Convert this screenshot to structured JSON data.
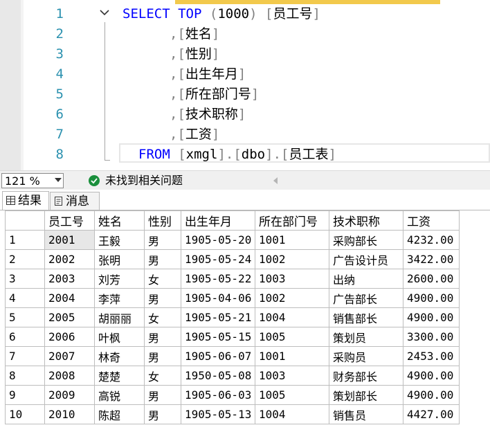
{
  "editor": {
    "lines": [
      {
        "num": "1",
        "parts": [
          [
            "kw",
            "SELECT"
          ],
          [
            "sp",
            " "
          ],
          [
            "kw",
            "TOP"
          ],
          [
            "sp",
            " "
          ],
          [
            "br",
            "("
          ],
          [
            "num",
            "1000"
          ],
          [
            "br",
            ")"
          ],
          [
            "sp",
            " "
          ],
          [
            "br",
            "["
          ],
          [
            "blk",
            "员工号"
          ],
          [
            "br",
            "]"
          ]
        ]
      },
      {
        "num": "2",
        "parts": [
          [
            "br",
            ","
          ],
          [
            "br",
            "["
          ],
          [
            "blk",
            "姓名"
          ],
          [
            "br",
            "]"
          ]
        ]
      },
      {
        "num": "3",
        "parts": [
          [
            "br",
            ","
          ],
          [
            "br",
            "["
          ],
          [
            "blk",
            "性别"
          ],
          [
            "br",
            "]"
          ]
        ]
      },
      {
        "num": "4",
        "parts": [
          [
            "br",
            ","
          ],
          [
            "br",
            "["
          ],
          [
            "blk",
            "出生年月"
          ],
          [
            "br",
            "]"
          ]
        ]
      },
      {
        "num": "5",
        "parts": [
          [
            "br",
            ","
          ],
          [
            "br",
            "["
          ],
          [
            "blk",
            "所在部门号"
          ],
          [
            "br",
            "]"
          ]
        ]
      },
      {
        "num": "6",
        "parts": [
          [
            "br",
            ","
          ],
          [
            "br",
            "["
          ],
          [
            "blk",
            "技术职称"
          ],
          [
            "br",
            "]"
          ]
        ]
      },
      {
        "num": "7",
        "parts": [
          [
            "br",
            ","
          ],
          [
            "br",
            "["
          ],
          [
            "blk",
            "工资"
          ],
          [
            "br",
            "]"
          ]
        ]
      },
      {
        "num": "8",
        "parts": [
          [
            "kw",
            "FROM"
          ],
          [
            "sp",
            " "
          ],
          [
            "br",
            "["
          ],
          [
            "blk",
            "xmgl"
          ],
          [
            "br",
            "]"
          ],
          [
            "br",
            "."
          ],
          [
            "br",
            "["
          ],
          [
            "blk",
            "dbo"
          ],
          [
            "br",
            "]"
          ],
          [
            "br",
            "."
          ],
          [
            "br",
            "["
          ],
          [
            "blk",
            "员工表"
          ],
          [
            "br",
            "]"
          ]
        ]
      }
    ]
  },
  "statusbar": {
    "zoom": "121 %",
    "status_text": "未找到相关问题"
  },
  "tabs": [
    {
      "label": "结果",
      "icon": "grid-icon"
    },
    {
      "label": "消息",
      "icon": "message-icon"
    }
  ],
  "grid": {
    "columns": [
      "",
      "员工号",
      "姓名",
      "性别",
      "出生年月",
      "所在部门号",
      "技术职称",
      "工资"
    ],
    "rows": [
      [
        "1",
        "2001",
        "王毅",
        "男",
        "1905-05-20",
        "1001",
        "采购部长",
        "4232.00"
      ],
      [
        "2",
        "2002",
        "张明",
        "男",
        "1905-05-24",
        "1002",
        "广告设计员",
        "3422.00"
      ],
      [
        "3",
        "2003",
        "刘芳",
        "女",
        "1905-05-22",
        "1003",
        "出纳",
        "2600.00"
      ],
      [
        "4",
        "2004",
        "李萍",
        "男",
        "1905-04-06",
        "1002",
        "广告部长",
        "4900.00"
      ],
      [
        "5",
        "2005",
        "胡丽丽",
        "女",
        "1905-05-21",
        "1004",
        "销售部长",
        "4900.00"
      ],
      [
        "6",
        "2006",
        "叶枫",
        "男",
        "1905-05-15",
        "1005",
        "策划员",
        "3300.00"
      ],
      [
        "7",
        "2007",
        "林奇",
        "男",
        "1905-06-07",
        "1001",
        "采购员",
        "2453.00"
      ],
      [
        "8",
        "2008",
        "楚楚",
        "女",
        "1950-05-08",
        "1003",
        "财务部长",
        "4900.00"
      ],
      [
        "9",
        "2009",
        "高锐",
        "男",
        "1905-06-03",
        "1005",
        "策划部长",
        "4900.00"
      ],
      [
        "10",
        "2010",
        "陈超",
        "男",
        "1905-05-13",
        "1004",
        "销售员",
        "4427.00"
      ]
    ]
  }
}
